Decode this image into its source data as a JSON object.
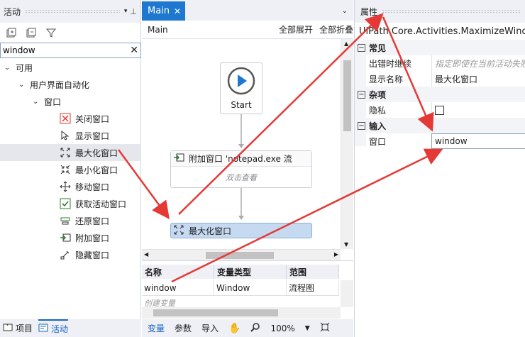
{
  "activities_panel": {
    "title": "活动",
    "search_value": "window",
    "tree": [
      {
        "label": "可用",
        "level": 0,
        "expanded": true
      },
      {
        "label": "用户界面自动化",
        "level": 1,
        "expanded": true
      },
      {
        "label": "窗口",
        "level": 2,
        "expanded": true
      },
      {
        "label": "关闭窗口",
        "level": 3,
        "icon": "close-window-icon"
      },
      {
        "label": "显示窗口",
        "level": 3,
        "icon": "show-window-icon"
      },
      {
        "label": "最大化窗口",
        "level": 3,
        "icon": "maximize-window-icon",
        "selected": true
      },
      {
        "label": "最小化窗口",
        "level": 3,
        "icon": "minimize-window-icon"
      },
      {
        "label": "移动窗口",
        "level": 3,
        "icon": "move-window-icon"
      },
      {
        "label": "获取活动窗口",
        "level": 3,
        "icon": "get-active-window-icon"
      },
      {
        "label": "还原窗口",
        "level": 3,
        "icon": "restore-window-icon"
      },
      {
        "label": "附加窗口",
        "level": 3,
        "icon": "attach-window-icon"
      },
      {
        "label": "隐藏窗口",
        "level": 3,
        "icon": "hide-window-icon"
      }
    ],
    "bottom_tabs": [
      "项目",
      "活动"
    ]
  },
  "designer": {
    "tab_label": "Main",
    "breadcrumb": "Main",
    "expand_all": "全部展开",
    "collapse_all": "全部折叠",
    "start_label": "Start",
    "attach_title": "附加窗口 'notepad.exe 流",
    "attach_hint": "双击查看",
    "maximize_label": "最大化窗口"
  },
  "variables": {
    "headers": [
      "名称",
      "变量类型",
      "范围"
    ],
    "rows": [
      {
        "name": "window",
        "type": "Window",
        "scope": "流程图"
      }
    ],
    "create_hint": "创建变量"
  },
  "designer_bar": {
    "tabs": [
      "变量",
      "参数",
      "导入"
    ],
    "zoom": "100%"
  },
  "properties": {
    "title": "属性",
    "class_name": "UiPath.Core.Activities.MaximizeWindow",
    "categories": [
      {
        "name": "常见",
        "props": [
          {
            "label": "出错时继续",
            "value": "指定即使在当前活动失败",
            "placeholder": true
          },
          {
            "label": "显示名称",
            "value": "最大化窗口"
          }
        ]
      },
      {
        "name": "杂项",
        "props": [
          {
            "label": "隐私",
            "value": "",
            "checkbox": true
          }
        ]
      },
      {
        "name": "输入",
        "props": [
          {
            "label": "窗口",
            "value": "window"
          }
        ]
      }
    ]
  },
  "colors": {
    "accent": "#1e78d0",
    "arrow": "#e53935",
    "selected_activity": "#c5daf0"
  }
}
